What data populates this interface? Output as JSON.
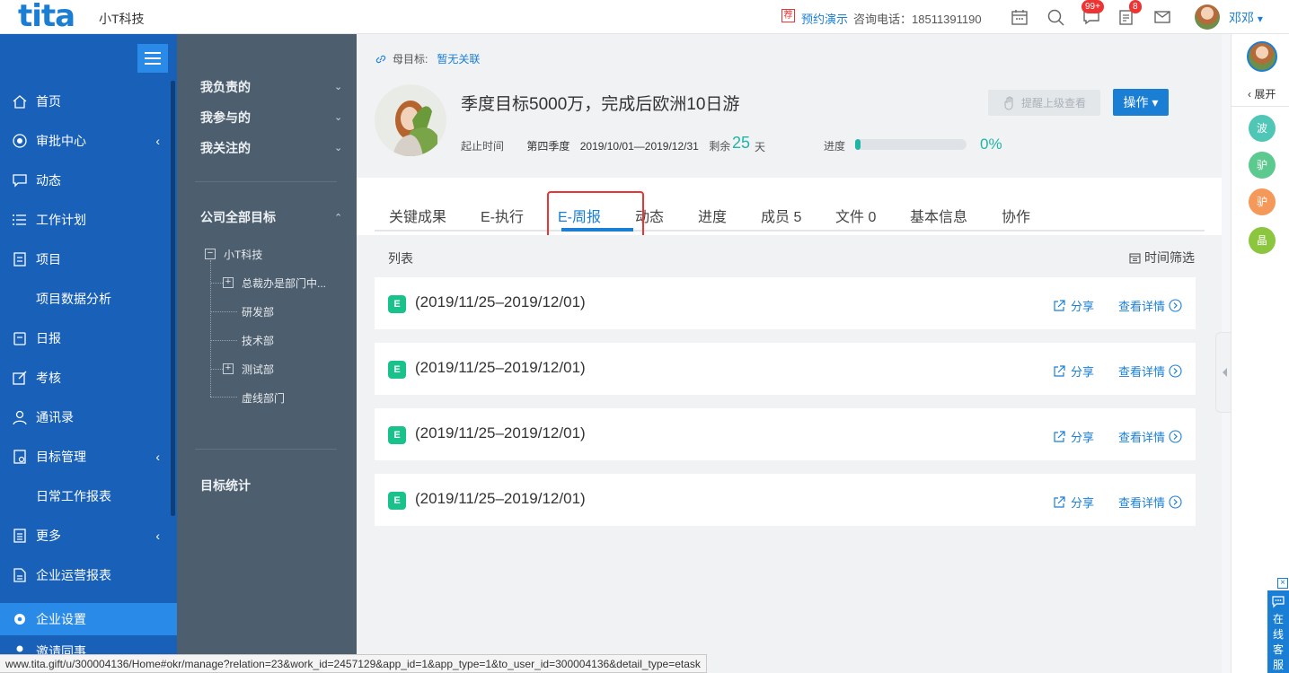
{
  "topbar": {
    "logo": "tita",
    "company": "小T科技",
    "recommend_tag": "荐",
    "demo_link": "预约演示",
    "phone": "咨询电话：18511391190",
    "badge_messages": "99+",
    "badge_tasks": "8",
    "user_name": "邓邓",
    "user_menu_caret": "▾"
  },
  "leftnav": {
    "items": [
      {
        "label": "首页",
        "icon": "home-icon"
      },
      {
        "label": "审批中心",
        "icon": "approval-icon",
        "chevron": "‹"
      },
      {
        "label": "动态",
        "icon": "activity-icon"
      },
      {
        "label": "工作计划",
        "icon": "plan-icon"
      },
      {
        "label": "项目",
        "icon": "project-icon"
      },
      {
        "label": "项目数据分析"
      },
      {
        "label": "日报",
        "icon": "daily-report-icon"
      },
      {
        "label": "考核",
        "icon": "assessment-icon"
      },
      {
        "label": "通讯录",
        "icon": "contacts-icon"
      },
      {
        "label": "目标管理",
        "icon": "goal-icon",
        "chevron": "‹"
      },
      {
        "label": "日常工作报表"
      },
      {
        "label": "更多",
        "icon": "more-icon",
        "chevron": "‹"
      },
      {
        "label": "企业运营报表",
        "icon": "report-icon"
      },
      {
        "label": "企业设置",
        "icon": "gear-icon"
      },
      {
        "label": "邀请同事",
        "icon": "invite-icon"
      }
    ]
  },
  "secondnav": {
    "my_responsible": "我负责的",
    "my_participated": "我参与的",
    "my_followed": "我关注的",
    "company_goals": "公司全部目标",
    "tree_root": "小T科技",
    "tree_items": [
      "总裁办是部门中...",
      "研发部",
      "技术部",
      "测试部",
      "虚线部门"
    ],
    "goal_stats": "目标统计",
    "caret_down": "⌄",
    "caret_up": "⌃"
  },
  "goal": {
    "parent_label": "母目标:",
    "parent_value": "暂无关联",
    "title": "季度目标5000万，完成后欧洲10日游",
    "time_label": "起止时间",
    "period": "第四季度",
    "date_range": "2019/10/01—2019/12/31",
    "remaining_label": "剩余",
    "remaining_days": "25",
    "remaining_unit": "天",
    "progress_label": "进度",
    "progress_value": 0.05,
    "progress_pct": "0%",
    "remind_button": "提醒上级查看",
    "operate_button": "操作 ▾"
  },
  "tabs": [
    "关键成果",
    "E-执行",
    "E-周报",
    "动态",
    "进度",
    "成员 5",
    "文件 0",
    "基本信息",
    "协作"
  ],
  "list": {
    "title": "列表",
    "time_filter": "时间筛选",
    "rows": [
      {
        "title": "(2019/11/25–2019/12/01)",
        "share": "分享",
        "detail": "查看详情"
      },
      {
        "title": "(2019/11/25–2019/12/01)",
        "share": "分享",
        "detail": "查看详情"
      },
      {
        "title": "(2019/11/25–2019/12/01)",
        "share": "分享",
        "detail": "查看详情"
      },
      {
        "title": "(2019/11/25–2019/12/01)",
        "share": "分享",
        "detail": "查看详情"
      }
    ]
  },
  "rightrail": {
    "expand": "展开",
    "members": [
      {
        "name": "波",
        "color": "#4fc6b6"
      },
      {
        "name": "驴",
        "color": "#5cc98e"
      },
      {
        "name": "驴",
        "color": "#f5995a"
      },
      {
        "name": "晶",
        "color": "#8cc63f"
      }
    ],
    "online_service": [
      "在",
      "线",
      "客",
      "服"
    ],
    "close": "×"
  },
  "statusbar": "www.tita.gift/u/300004136/Home#okr/manage?relation=23&work_id=2457129&app_id=1&app_type=1&to_user_id=300004136&detail_type=etask",
  "colors": {
    "brand": "#1a7fd4",
    "nav": "#1860b8",
    "secondnav": "#4d5e6e",
    "accent_teal": "#21b5a6",
    "highlight": "#e33333"
  }
}
